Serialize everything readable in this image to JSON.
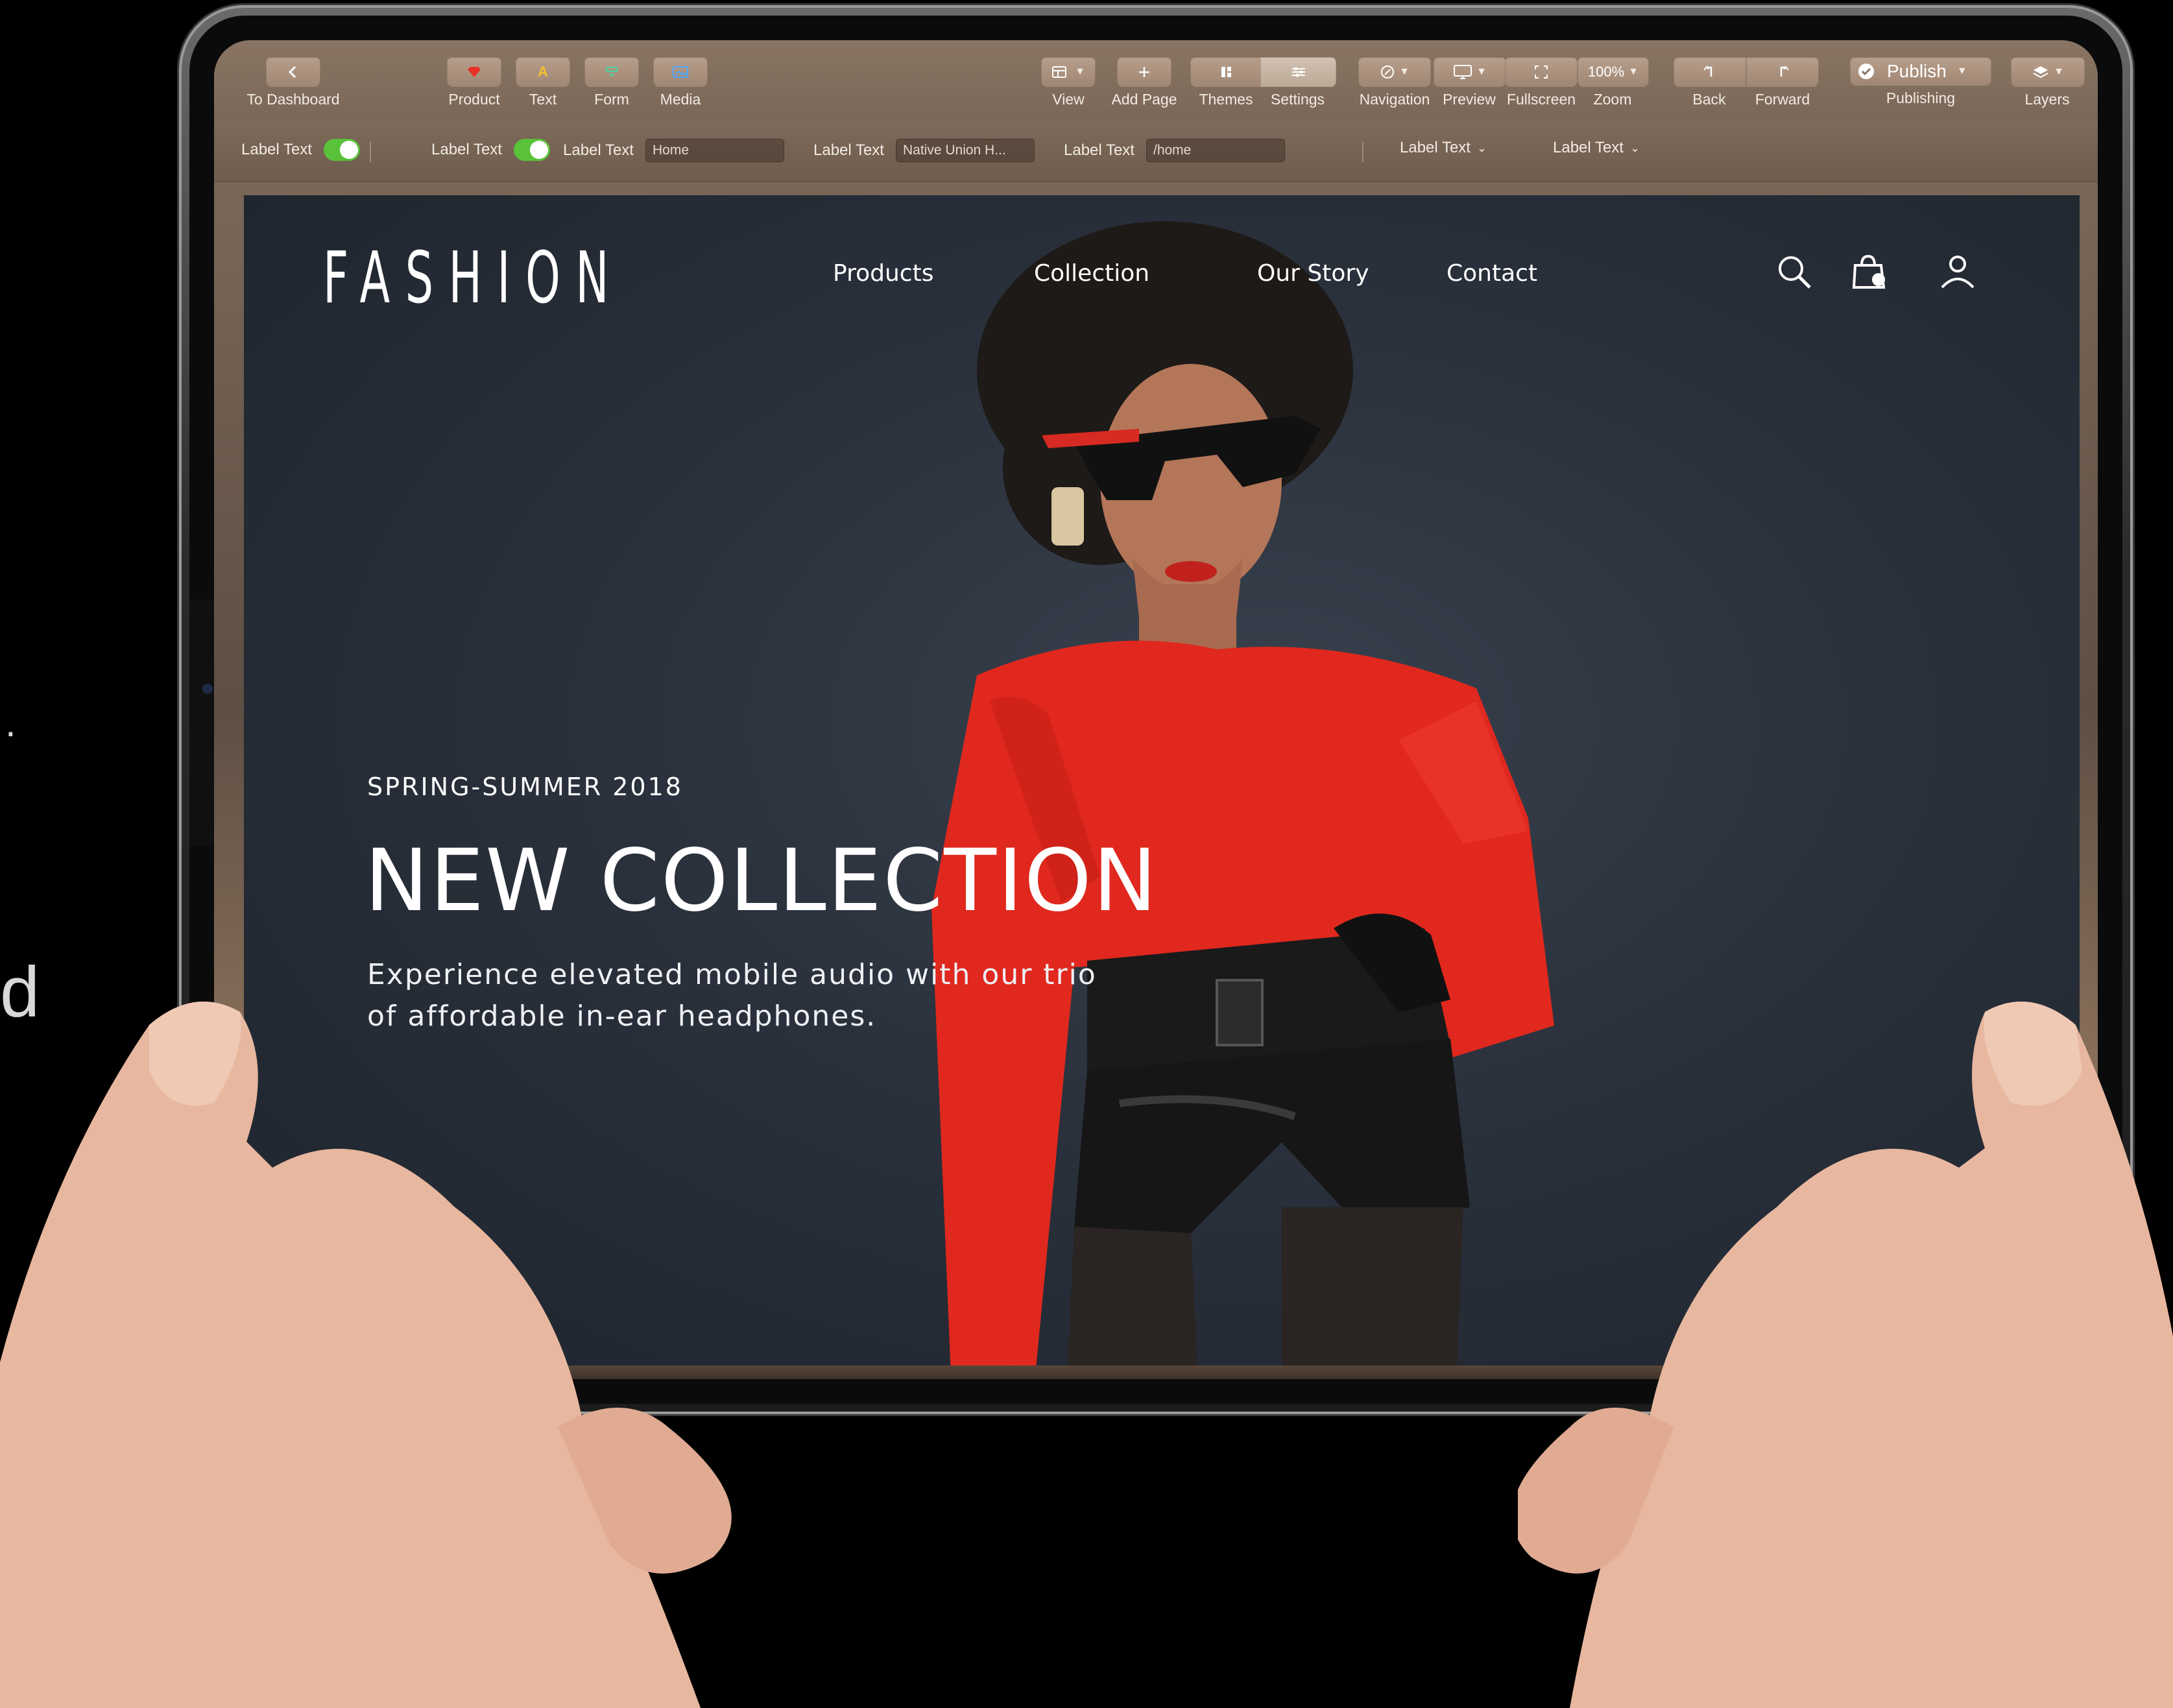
{
  "toolbar": {
    "to_dashboard": "To Dashboard",
    "product": "Product",
    "text": "Text",
    "form": "Form",
    "media": "Media",
    "view": "View",
    "add_page": "Add Page",
    "themes": "Themes",
    "settings": "Settings",
    "navigation": "Navigation",
    "preview": "Preview",
    "fullscreen": "Fullscreen",
    "zoom_value": "100%",
    "zoom": "Zoom",
    "back": "Back",
    "forward": "Forward",
    "publish_button": "Publish",
    "publishing": "Publishing",
    "layers": "Layers"
  },
  "propbar": {
    "label1": "Label Text",
    "label2": "Label Text",
    "label3": "Label Text",
    "input3": "Home",
    "label4": "Label Text",
    "input4": "Native Union H...",
    "label5": "Label Text",
    "input5": "/home",
    "label6": "Label Text",
    "label7": "Label Text",
    "toggle_color": "#5ac13a"
  },
  "site": {
    "logo": "FASHION",
    "nav": [
      "Products",
      "Collection",
      "Our Story",
      "Contact"
    ],
    "icons": [
      "search-icon",
      "shopping-bag-icon",
      "user-icon"
    ],
    "eyebrow": "SPRING-SUMMER 2018",
    "headline": "NEW COLLECTION",
    "subtext_line1": "Experience elevated mobile audio with our trio",
    "subtext_line2": "of affordable in-ear headphones."
  },
  "edge": {
    "dot": ".",
    "char": "d"
  },
  "colors": {
    "sweater": "#e0281e",
    "background": "#2a313c",
    "toolbar": "#8a7564"
  }
}
